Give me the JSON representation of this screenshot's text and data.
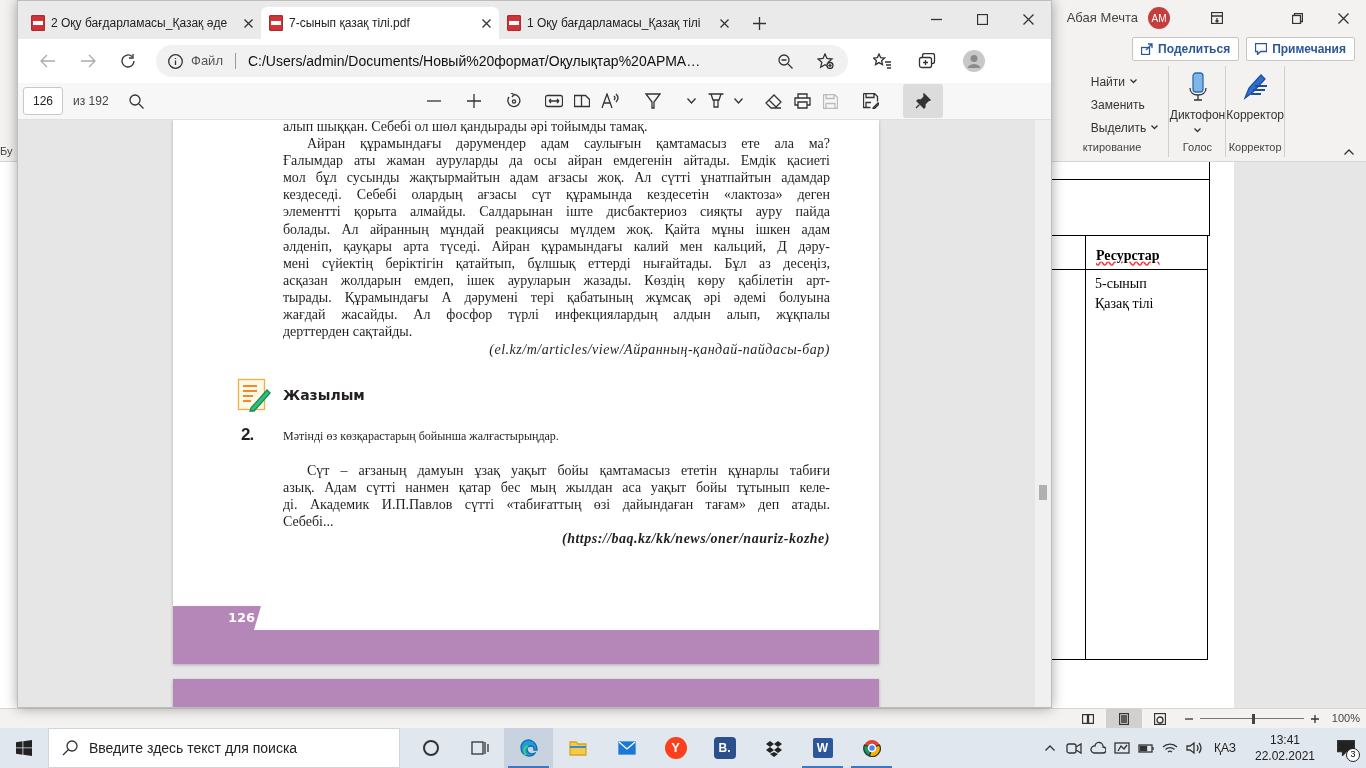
{
  "word": {
    "user": "Абая Мечта",
    "avatar": "AM",
    "share": "Поделиться",
    "comments": "Примечания",
    "left_group_label": "Бу",
    "editing": {
      "items": [
        {
          "label": "Найти",
          "dropdown": true
        },
        {
          "label": "Заменить",
          "dropdown": false
        },
        {
          "label": "Выделить",
          "dropdown": true
        }
      ],
      "group": "ктирование"
    },
    "voice": {
      "button": "Диктофон",
      "group": "Голос"
    },
    "editor": {
      "button": "Корректор",
      "group": "Корректор"
    },
    "table": {
      "header": "Ресурстар",
      "cell_lines": [
        "5-сынып",
        "Қазақ тілі"
      ]
    },
    "views": [
      {
        "kind": "read",
        "selected": false
      },
      {
        "kind": "print",
        "selected": true
      },
      {
        "kind": "web",
        "selected": false
      }
    ],
    "zoom": {
      "level": 0.5,
      "reading": "100%"
    }
  },
  "edge": {
    "tabs": [
      {
        "title": "2 Оқу бағдарламасы_Қазақ әде",
        "selected": false
      },
      {
        "title": "7-сынып қазақ тілі.pdf",
        "selected": true
      },
      {
        "title": "1 Оқу бағдарламасы_Қазақ тілі",
        "selected": false
      }
    ],
    "address": {
      "scheme": "Файл",
      "url": "C:/Users/admin/Documents/Новый%20формат/Оқулықтар%20АРМА…"
    },
    "pdf_toolbar": {
      "page": "126",
      "total": "из 192",
      "pinned": true
    },
    "page": {
      "top_line": "алып шыққан. Себебі ол шөл қандырады әрі тойымды тамақ.",
      "paragraph_1": [
        "Айран құрамындағы дәрумендер адам саулығын қамтамасыз ете ала ма?",
        "Ғалымдар аты жаман ауруларды да осы айран емдегенін айтады. Емдік қасиеті",
        "мол бұл сусынды жақтырмайтын адам ағзасы жоқ. Ал сүтті ұнатпайтын адамдар",
        "кездеседі. Себебі олардың ағзасы сүт құрамында кездесетін «лактоза» деген",
        "элементті қорыта алмайды. Салдарынан іште дисбактериоз сияқты ауру пайда",
        "болады. Ал айранның мұндай реакциясы мүлдем жоқ. Қайта мұны ішкен адам",
        "әлденіп, қауқары арта түседі. Айран құрамындағы калий мен кальций, Д дәру-",
        "мені сүйектің беріктігін қатайтып, бұлшық еттерді нығайтады. Бұл аз десеңіз,",
        "асқазан жолдарын емдеп, ішек ауруларын жазады. Көздің көру қабілетін арт-",
        "тырады. Құрамындағы А дәрумені тері қабатының жұмсақ әрі әдемі болуына",
        "жағдай жасайды. Ал фосфор түрлі инфекциялардың алдын алып, жұқпалы",
        "дерттерден сақтайды."
      ],
      "source_1": "(el.kz/m/articles/view/Айранның-қандай-пайдасы-бар)",
      "section": "Жазылым",
      "task_number": "2.",
      "task": "Мәтінді өз көзқарастарың бойынша жалғастырыңдар.",
      "paragraph_2": [
        "Сүт – ағзаның дамуын ұзақ уақыт бойы қамтамасыз ететін құнарлы табиғи",
        "азық. Адам сүтті нанмен қатар бес мың жылдан аса уақыт бойы тұтынып келе-",
        "ді. Академик И.П.Павлов сүтті «табиғаттың өзі дайындаған тағам» деп атады.",
        "Себебі..."
      ],
      "source_2": "(https://baq.kz/kk/news/oner/nauriz-kozhe)",
      "page_number": "126"
    }
  },
  "taskbar": {
    "search_placeholder": "Введите здесь текст для поиска",
    "apps": [
      {
        "kind": "cortana",
        "open": false,
        "selected": false
      },
      {
        "kind": "taskview",
        "open": false,
        "selected": false
      },
      {
        "kind": "edge",
        "open": true,
        "selected": true
      },
      {
        "kind": "explorer",
        "open": false,
        "selected": false
      },
      {
        "kind": "mail",
        "open": false,
        "selected": false
      },
      {
        "kind": "yandex",
        "glyph": "Y",
        "open": false,
        "selected": false
      },
      {
        "kind": "b",
        "glyph": "B.",
        "open": false,
        "selected": false
      },
      {
        "kind": "dropbox",
        "open": false,
        "selected": false
      },
      {
        "kind": "word",
        "glyph": "W",
        "open": true,
        "selected": false
      },
      {
        "kind": "chrome",
        "open": true,
        "selected": false
      }
    ],
    "language": "ҚАЗ",
    "time": "13:41",
    "date": "22.02.2021",
    "notifications": "3"
  }
}
